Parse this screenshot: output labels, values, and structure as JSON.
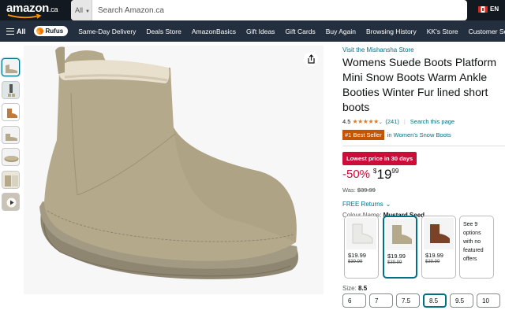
{
  "header": {
    "logo": "amazon",
    "logo_tld": ".ca",
    "search_category": "All",
    "search_placeholder": "Search Amazon.ca",
    "language": "EN"
  },
  "nav": {
    "all": "All",
    "rufus": "Rufus",
    "items": [
      "Same-Day Delivery",
      "Deals Store",
      "AmazonBasics",
      "Gift Ideas",
      "Gift Cards",
      "Buy Again",
      "Browsing History",
      "KK's Store",
      "Customer Service"
    ]
  },
  "product": {
    "store_link": "Visit the Mishansha Store",
    "title": "Womens Suede Boots Platform Mini Snow Boots Warm Ankle Booties Winter Fur lined short boots",
    "rating": "4.5",
    "review_count": "(241)",
    "search_page": "Search this page",
    "best_seller_badge": "#1 Best Seller",
    "best_seller_category": "in Women's Snow Boots",
    "deal_badge": "Lowest price in 30 days",
    "discount": "-50%",
    "price_currency": "$",
    "price_whole": "19",
    "price_fraction": "99",
    "was_label": "Was:",
    "was_price": "$39.99",
    "returns": "FREE Returns",
    "colour_label": "Colour Name:",
    "colour_value": "Mustard Seed",
    "swatches": [
      {
        "price": "$19.99",
        "list": "$39.99"
      },
      {
        "price": "$19.99",
        "list": "$39.99"
      },
      {
        "price": "$19.99",
        "list": "$39.99"
      }
    ],
    "more_options": "See 9 options with no featured offers",
    "size_label": "Size:",
    "size_value": "8.5",
    "sizes": [
      "6",
      "7",
      "7.5",
      "8.5",
      "9.5",
      "10"
    ]
  },
  "colors": {
    "header_bg": "#131921",
    "nav_bg": "#232f3e",
    "search_button": "#febd69",
    "link": "#007185",
    "deal_red": "#cc0c39",
    "best_seller_orange": "#c45500",
    "boot_tan": "#b4a98a"
  },
  "icons": [
    "hamburger-icon",
    "search-icon",
    "canada-flag-icon",
    "share-icon",
    "chevron-down-icon",
    "star-icon"
  ]
}
